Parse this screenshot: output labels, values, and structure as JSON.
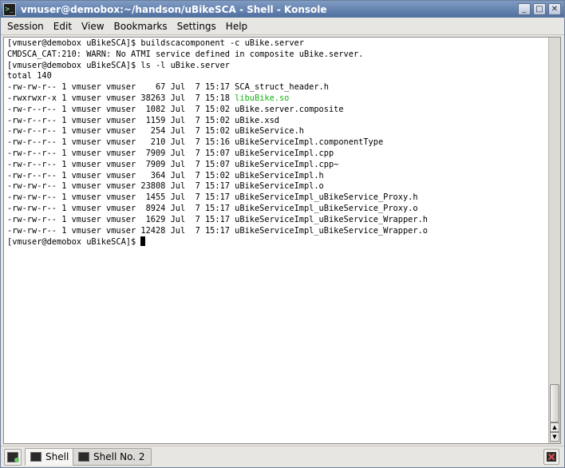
{
  "window": {
    "title": "vmuser@demobox:~/handson/uBikeSCA - Shell - Konsole",
    "controls": {
      "minimize": "_",
      "maximize": "□",
      "close": "✕"
    }
  },
  "menubar": {
    "items": [
      "Session",
      "Edit",
      "View",
      "Bookmarks",
      "Settings",
      "Help"
    ]
  },
  "terminal": {
    "lines": [
      {
        "text": "[vmuser@demobox uBikeSCA]$ buildscacomponent -c uBike.server"
      },
      {
        "text": "CMDSCA_CAT:210: WARN: No ATMI service defined in composite uBike.server."
      },
      {
        "text": "[vmuser@demobox uBikeSCA]$ ls -l uBike.server"
      },
      {
        "text": "total 140"
      },
      {
        "text": "-rw-rw-r-- 1 vmuser vmuser    67 Jul  7 15:17 ",
        "name": "SCA_struct_header.h"
      },
      {
        "text": "-rwxrwxr-x 1 vmuser vmuser 38263 Jul  7 15:18 ",
        "name": "libuBike.so",
        "highlight": true
      },
      {
        "text": "-rw-r--r-- 1 vmuser vmuser  1082 Jul  7 15:02 ",
        "name": "uBike.server.composite"
      },
      {
        "text": "-rw-r--r-- 1 vmuser vmuser  1159 Jul  7 15:02 ",
        "name": "uBike.xsd"
      },
      {
        "text": "-rw-r--r-- 1 vmuser vmuser   254 Jul  7 15:02 ",
        "name": "uBikeService.h"
      },
      {
        "text": "-rw-r--r-- 1 vmuser vmuser   210 Jul  7 15:16 ",
        "name": "uBikeServiceImpl.componentType"
      },
      {
        "text": "-rw-r--r-- 1 vmuser vmuser  7909 Jul  7 15:07 ",
        "name": "uBikeServiceImpl.cpp"
      },
      {
        "text": "-rw-r--r-- 1 vmuser vmuser  7909 Jul  7 15:07 ",
        "name": "uBikeServiceImpl.cpp~"
      },
      {
        "text": "-rw-r--r-- 1 vmuser vmuser   364 Jul  7 15:02 ",
        "name": "uBikeServiceImpl.h"
      },
      {
        "text": "-rw-rw-r-- 1 vmuser vmuser 23808 Jul  7 15:17 ",
        "name": "uBikeServiceImpl.o"
      },
      {
        "text": "-rw-rw-r-- 1 vmuser vmuser  1455 Jul  7 15:17 ",
        "name": "uBikeServiceImpl_uBikeService_Proxy.h"
      },
      {
        "text": "-rw-rw-r-- 1 vmuser vmuser  8924 Jul  7 15:17 ",
        "name": "uBikeServiceImpl_uBikeService_Proxy.o"
      },
      {
        "text": "-rw-rw-r-- 1 vmuser vmuser  1629 Jul  7 15:17 ",
        "name": "uBikeServiceImpl_uBikeService_Wrapper.h"
      },
      {
        "text": "-rw-rw-r-- 1 vmuser vmuser 12428 Jul  7 15:17 ",
        "name": "uBikeServiceImpl_uBikeService_Wrapper.o"
      }
    ],
    "prompt": "[vmuser@demobox uBikeSCA]$ ",
    "highlight_color": "#18b218"
  },
  "tabs": {
    "items": [
      {
        "label": "Shell",
        "active": true
      },
      {
        "label": "Shell No. 2",
        "active": false
      }
    ]
  }
}
